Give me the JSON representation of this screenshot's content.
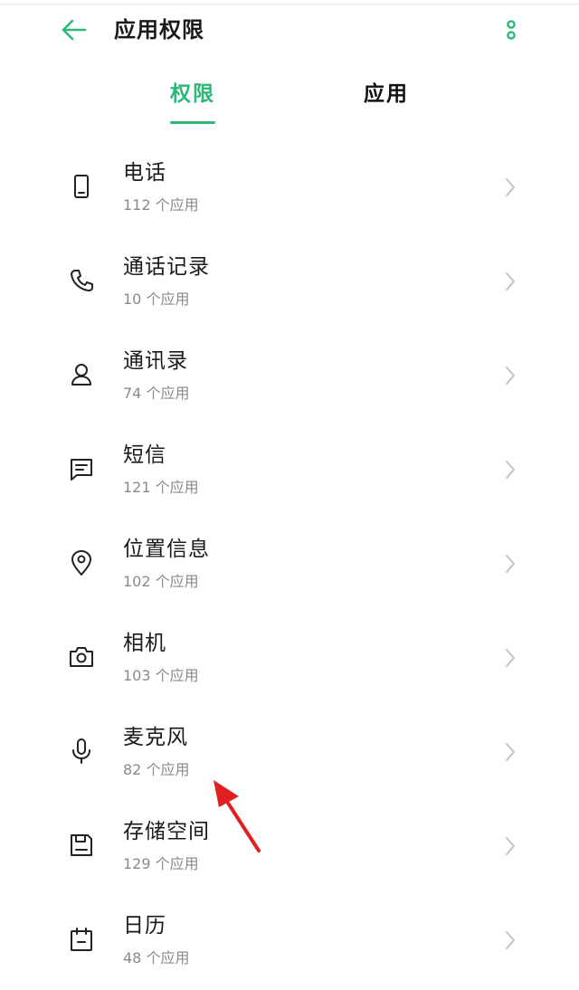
{
  "header": {
    "title": "应用权限",
    "back_icon": "arrow-left-icon",
    "more_icon": "more-vertical-icon",
    "accent_color": "#2eb877"
  },
  "tabs": [
    {
      "label": "权限",
      "active": true
    },
    {
      "label": "应用",
      "active": false
    }
  ],
  "permissions": [
    {
      "icon": "phone-device-icon",
      "title": "电话",
      "count": "112 个应用"
    },
    {
      "icon": "phone-handset-icon",
      "title": "通话记录",
      "count": "10 个应用"
    },
    {
      "icon": "contact-person-icon",
      "title": "通讯录",
      "count": "74 个应用"
    },
    {
      "icon": "message-icon",
      "title": "短信",
      "count": "121 个应用"
    },
    {
      "icon": "location-pin-icon",
      "title": "位置信息",
      "count": "102 个应用"
    },
    {
      "icon": "camera-icon",
      "title": "相机",
      "count": "103 个应用"
    },
    {
      "icon": "microphone-icon",
      "title": "麦克风",
      "count": "82 个应用"
    },
    {
      "icon": "storage-icon",
      "title": "存储空间",
      "count": "129 个应用"
    },
    {
      "icon": "calendar-icon",
      "title": "日历",
      "count": "48 个应用"
    }
  ],
  "annotation": {
    "icon": "red-arrow-annotation",
    "color": "#e02020"
  }
}
